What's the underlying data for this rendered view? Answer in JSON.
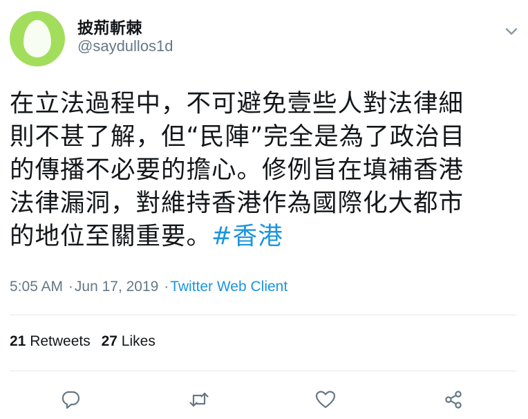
{
  "user": {
    "display_name": "披荊斬棘",
    "handle": "@saydullos1d",
    "avatar_color": "#a3dd5c"
  },
  "tweet": {
    "lines": [
      "在立法過程中，不可避免壹些人對法律細",
      "則不甚了解，但“民陣”完全是為了政治目",
      "的傳播不必要的擔心。修例旨在填補香港",
      "法律漏洞，對維持香港作為國際化大都市"
    ],
    "last_line_text": "的地位至關重要。",
    "hashtag": "#香港",
    "hashtag_color": "#1b95e0"
  },
  "meta": {
    "time": "5:05 AM",
    "separator": "·",
    "date": "Jun 17, 2019",
    "client": "Twitter Web Client"
  },
  "stats": {
    "retweets_count": "21",
    "retweets_label": "Retweets",
    "likes_count": "27",
    "likes_label": "Likes"
  },
  "actions": {
    "reply_icon": "reply-icon",
    "retweet_icon": "retweet-icon",
    "like_icon": "heart-icon",
    "share_icon": "share-icon",
    "icon_color": "#657786"
  }
}
